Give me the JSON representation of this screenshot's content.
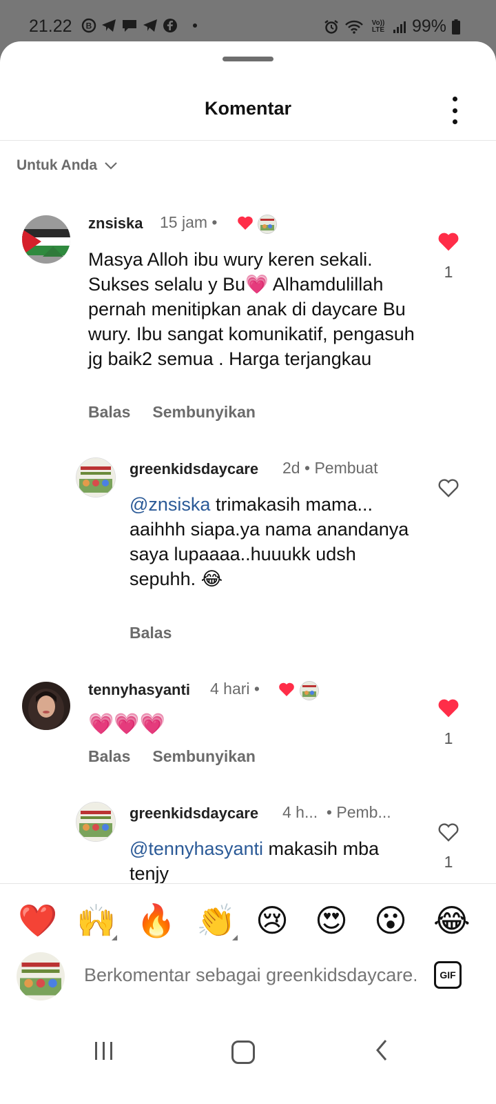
{
  "status_bar": {
    "time": "21.22",
    "lte_label": "Vo)) LTE",
    "battery": "99%"
  },
  "sheet": {
    "title": "Komentar",
    "sort_label": "Untuk Anda"
  },
  "comments": [
    {
      "username": "znsiska",
      "time": "15 jam",
      "text": "Masya Alloh ibu wury keren sekali. Sukses selalu y Bu💗 Alhamdulillah pernah menitipkan anak di daycare Bu wury. Ibu sangat komunikatif, pengasuh jg baik2 semua . Harga terjangkau",
      "reply_label": "Balas",
      "hide_label": "Sembunyikan",
      "likes": "1",
      "liked": true
    },
    {
      "username": "greenkidsdaycare",
      "time": "2d",
      "creator_label": "Pembuat",
      "mention": "@znsiska",
      "text": " trimakasih mama... aaihhh siapa.ya nama anandanya saya lupaaaa..huuukk udsh sepuhh. 😂",
      "reply_label": "Balas",
      "liked": false
    },
    {
      "username": "tennyhasyanti",
      "time": "4 hari",
      "text": "💗💗💗",
      "reply_label": "Balas",
      "hide_label": "Sembunyikan",
      "likes": "1",
      "liked": true
    },
    {
      "username": "greenkidsdaycare",
      "time": "4 h...",
      "creator_label": "Pemb...",
      "mention": "@tennyhasyanti",
      "text": " makasih mba tenjy",
      "likes": "1",
      "liked": false
    }
  ],
  "emoji_bar": [
    "❤️",
    "🙌",
    "🔥",
    "👏",
    "😢",
    "😍",
    "😮",
    "😂"
  ],
  "input": {
    "placeholder": "Berkomentar sebagai greenkidsdaycare...",
    "gif_label": "GIF"
  },
  "colors": {
    "heart_red": "#ff2d48",
    "mention_blue": "#2b5a97",
    "muted": "#6b6b6b"
  }
}
